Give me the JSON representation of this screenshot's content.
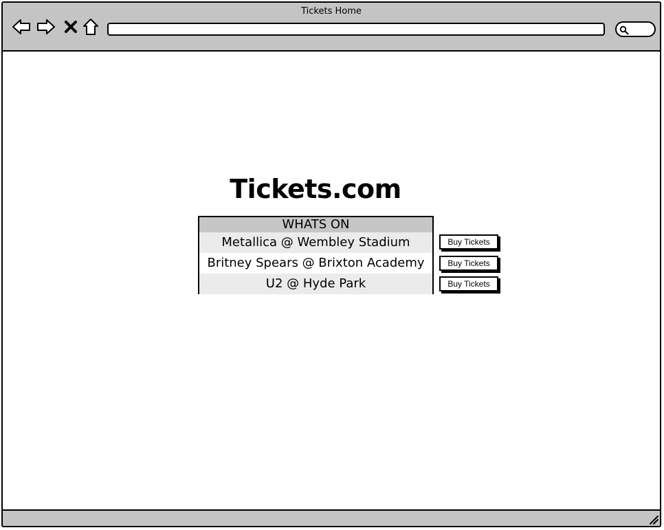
{
  "window": {
    "title": "Tickets Home"
  },
  "browser": {
    "address_value": "",
    "search_value": ""
  },
  "page": {
    "site_title": "Tickets.com",
    "table_header": "WHATS ON",
    "events": [
      {
        "name": "Metallica @ Wembley Stadium",
        "button_label": "Buy Tickets"
      },
      {
        "name": "Britney Spears @ Brixton Academy",
        "button_label": "Buy Tickets"
      },
      {
        "name": "U2 @ Hyde Park",
        "button_label": "Buy Tickets"
      }
    ]
  },
  "icons": {
    "back": "back-arrow-icon",
    "forward": "forward-arrow-icon",
    "stop": "close-icon",
    "home": "home-icon",
    "search": "search-icon",
    "resize": "resize-grip-icon"
  },
  "colors": {
    "chrome": "#c4c4c4",
    "header": "#c6c6c6",
    "row_shaded": "#ebebeb",
    "border": "#000000"
  }
}
